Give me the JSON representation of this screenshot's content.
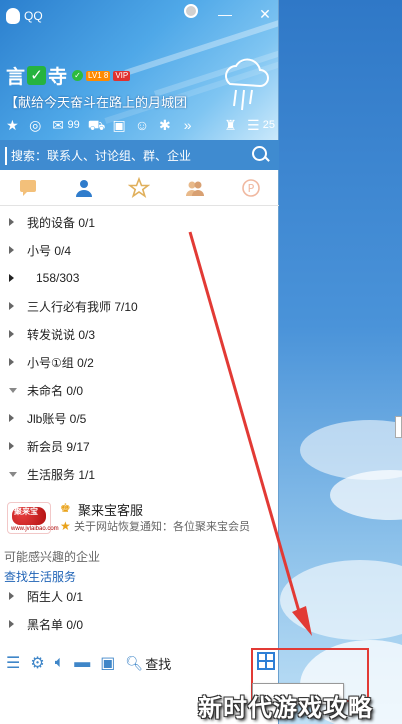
{
  "app": {
    "title": "QQ"
  },
  "colors": {
    "accent": "#3f8bd0",
    "arrow": "#e23a35",
    "online_badge": "#2dbb3e"
  },
  "profile": {
    "nickname_a": "言",
    "nickname_b": "寺",
    "level_badge": "LV1",
    "level_sub": "8",
    "vip_badge": "VIP",
    "signature": "【献给今天奋斗在路上的月城团"
  },
  "toolbar": {
    "mail_count": "99",
    "skin_count": "25"
  },
  "search": {
    "placeholder": "搜索：联系人、讨论组、群、企业"
  },
  "tabs": [
    "messages-tab",
    "contacts-tab",
    "favorites-tab",
    "groups-tab",
    "zone-tab"
  ],
  "groups": [
    {
      "label": "我的设备  0/1",
      "expanded": false
    },
    {
      "label": "小号  0/4",
      "expanded": false
    },
    {
      "label": "158/303",
      "expanded": false
    },
    {
      "label": "三人行必有我师  7/10",
      "expanded": false
    },
    {
      "label": "转发说说  0/3",
      "expanded": false
    },
    {
      "label": "小号①组  0/2",
      "expanded": false
    },
    {
      "label": "未命名  0/0",
      "expanded": true
    },
    {
      "label": "Jlb账号  0/5",
      "expanded": false
    },
    {
      "label": "新会员  9/17",
      "expanded": false
    },
    {
      "label": "生活服务  1/1",
      "expanded": true
    }
  ],
  "contact": {
    "logo_text": "聚来宝",
    "logo_sub": "www.jvlaibao.com",
    "name": "聚来宝客服",
    "message": "关于网站恢复通知：各位聚来宝会员"
  },
  "section": {
    "maybe_interested": "可能感兴趣的企业",
    "find_service": "查找生活服务"
  },
  "groups_after": [
    {
      "label": "陌生人  0/1"
    },
    {
      "label": "黑名单  0/0"
    }
  ],
  "bottom": {
    "find_label": "查找"
  },
  "watermark": "新时代游戏攻略"
}
